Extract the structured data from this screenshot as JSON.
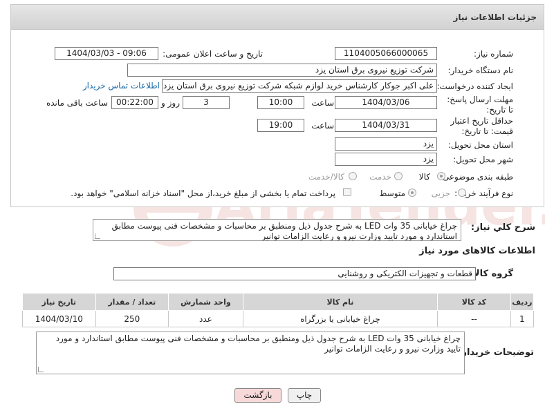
{
  "header": {
    "title": "جزئیات اطلاعات نیاز"
  },
  "labels": {
    "need_number": "شماره نیاز:",
    "announce_datetime": "تاریخ و ساعت اعلان عمومی:",
    "buyer_org": "نام دستگاه خریدار:",
    "requester": "ایجاد کننده درخواست:",
    "reply_deadline": "مهلت ارسال پاسخ: تا تاریخ:",
    "price_validity": "حداقل تاریخ اعتبار قیمت: تا تاریخ:",
    "delivery_province": "استان محل تحویل:",
    "delivery_city": "شهر محل تحویل:",
    "category": "طبقه بندی موضوعی:",
    "purchase_type": "نوع فرآیند خرید :",
    "time": "ساعت",
    "days_and": "روز و",
    "remaining": "ساعت باقی مانده",
    "general_desc": "شرح کلي نياز:",
    "goods_info": "اطلاعات کالاهای مورد نیاز",
    "goods_group": "گروه کالا:",
    "buyer_notes": "توضیحات خریدار:"
  },
  "values": {
    "need_number": "1104005066000065",
    "announce_datetime": "1404/03/03 - 09:06",
    "buyer_org": "شرکت توزیع نیروی برق استان یزد",
    "requester": "علی اکبر  جوکار  کارشناس خرید لوازم شبکه  شرکت توزیع نیروی برق استان یزد",
    "contact_link": "اطلاعات تماس خریدار",
    "reply_date": "1404/03/06",
    "reply_time": "10:00",
    "reply_days": "3",
    "reply_remaining": "00:22:00",
    "validity_date": "1404/03/31",
    "validity_time": "19:00",
    "province": "یزد",
    "city": "یزد"
  },
  "category_options": [
    {
      "label": "کالا",
      "checked": true
    },
    {
      "label": "خدمت",
      "checked": false
    },
    {
      "label": "کالا/خدمت",
      "checked": false
    }
  ],
  "purchase_options": [
    {
      "label": "جزیی",
      "checked": false
    },
    {
      "label": "متوسط",
      "checked": true
    }
  ],
  "payment_note": "پرداخت تمام یا بخشی از مبلغ خرید،از محل \"اسناد خزانه اسلامی\" خواهد بود.",
  "general_desc": "چراغ خیابانی 35 وات LED  به شرح جدول ذیل ومنطبق بر  محاسبات و مشخصات فنی پیوست مطابق استاندارد و مورد تایید وزارت نیرو  و رعایت الزامات توانیر",
  "goods_group": "قطعات و تجهیزات الکتریکی و روشنایی",
  "table": {
    "headers": [
      "ردیف",
      "کد کالا",
      "نام کالا",
      "واحد شمارش",
      "تعداد / مقدار",
      "تاریخ نیاز"
    ],
    "rows": [
      [
        "1",
        "--",
        "چراغ خیابانی یا بزرگراه",
        "عدد",
        "250",
        "1404/03/10"
      ]
    ]
  },
  "buyer_notes": "چراغ خیابانی 35 وات LED  به شرح جدول ذیل ومنطبق بر  محاسبات و مشخصات فنی پیوست مطابق استاندارد و مورد تایید وزارت نیرو  و رعایت الزامات توانیر",
  "buttons": {
    "print": "چاپ",
    "back": "بازگشت"
  },
  "watermark": "AriaTender.neT",
  "colors": {
    "link": "#1a6aa8",
    "back_button_bg": "#f7d9da",
    "watermark": "#c0392b"
  }
}
